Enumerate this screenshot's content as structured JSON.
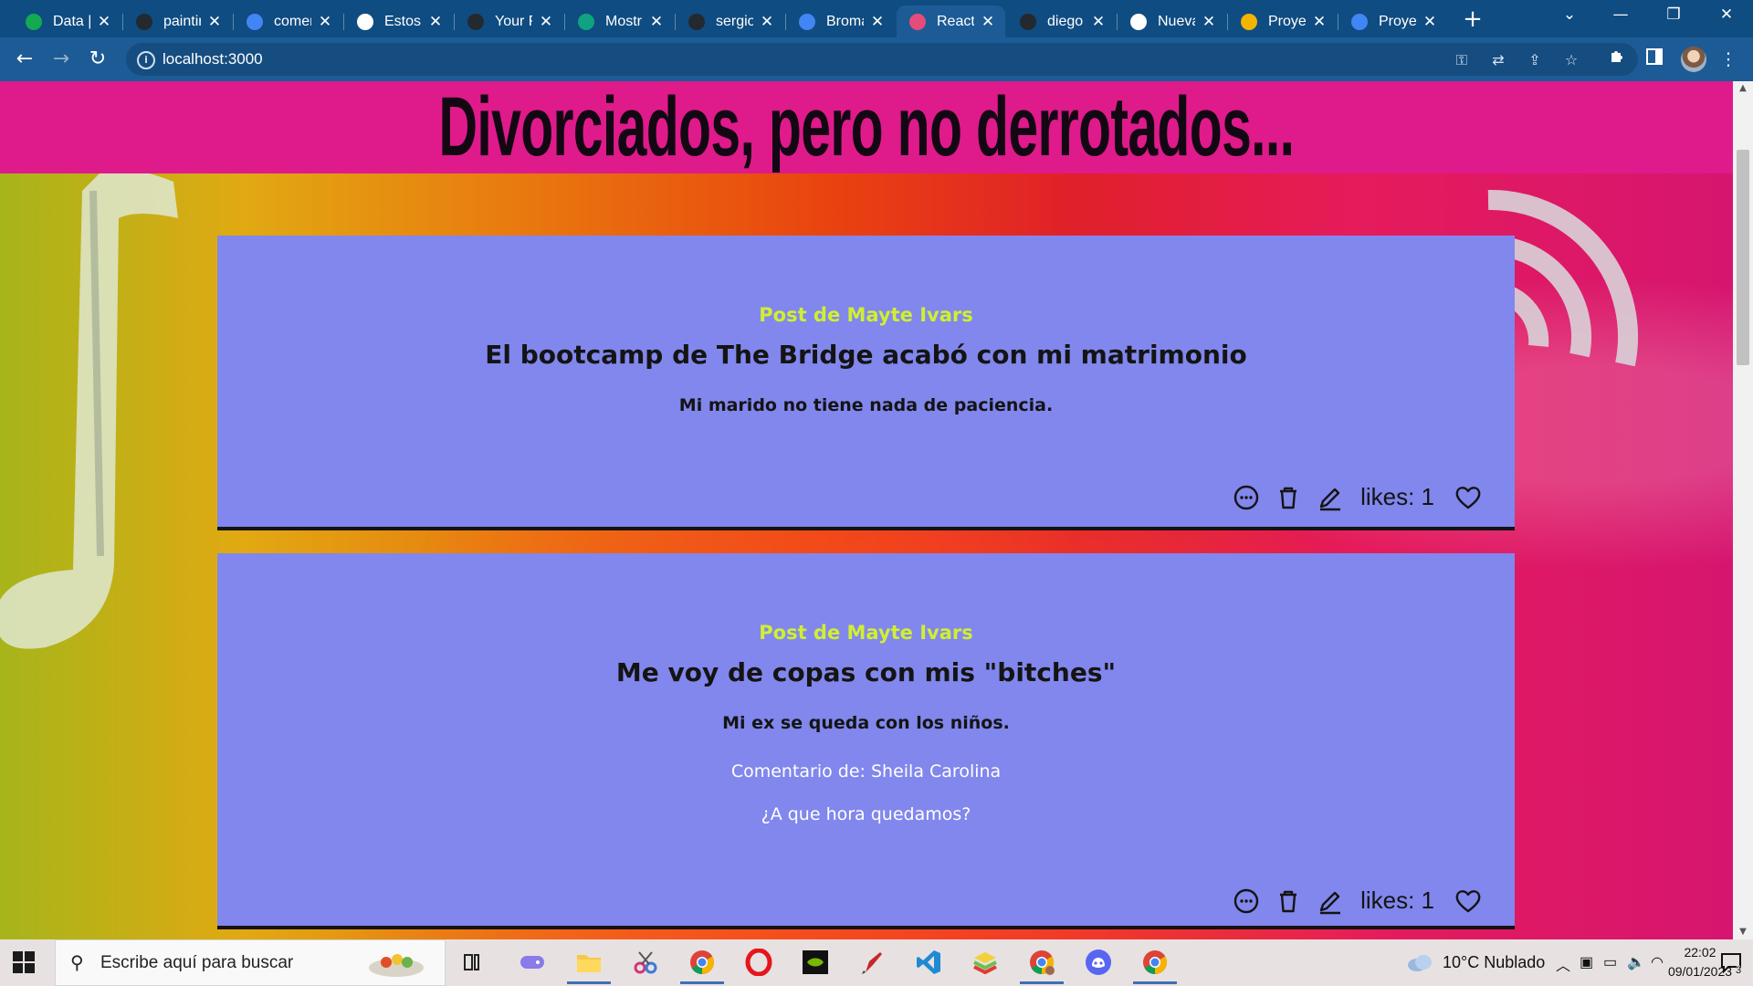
{
  "browser": {
    "tabs": [
      {
        "title": "Data |",
        "icon": "mongodb-leaf-icon",
        "color": "#13aa52"
      },
      {
        "title": "paintin",
        "icon": "github-icon",
        "color": "#24292f"
      },
      {
        "title": "comen",
        "icon": "google-icon",
        "color": "#4285f4"
      },
      {
        "title": "Estos",
        "icon": "skull-icon",
        "color": "#ffffff"
      },
      {
        "title": "Your R",
        "icon": "github-icon",
        "color": "#24292f"
      },
      {
        "title": "Mostr",
        "icon": "openai-icon",
        "color": "#10a37f"
      },
      {
        "title": "sergio",
        "icon": "github-icon",
        "color": "#24292f"
      },
      {
        "title": "Broma",
        "icon": "google-icon",
        "color": "#4285f4"
      },
      {
        "title": "React",
        "icon": "react-app-icon",
        "color": "#e54c7a",
        "active": true
      },
      {
        "title": "diego",
        "icon": "github-icon",
        "color": "#24292f"
      },
      {
        "title": "Nueva",
        "icon": "chrome-icon",
        "color": "#ffffff"
      },
      {
        "title": "Proye",
        "icon": "classroom-icon",
        "color": "#f4b400"
      },
      {
        "title": "Proye",
        "icon": "docs-icon",
        "color": "#4285f4"
      }
    ],
    "address": "localhost:3000"
  },
  "page": {
    "banner_title": "Divorciados, pero no derrotados...",
    "banner_color": "#df1a8b",
    "card_color": "#8187ec",
    "author_color": "#d0ef32",
    "posts": [
      {
        "author": "Post de Mayte Ivars",
        "title": "El bootcamp de The Bridge acabó con mi matrimonio",
        "body": "Mi marido no tiene nada de paciencia.",
        "likes": "likes: 1"
      },
      {
        "author": "Post de Mayte Ivars",
        "title": "Me voy de copas con mis \"bitches\"",
        "body": "Mi ex se queda con los niños.",
        "comment_author": "Comentario de: Sheila Carolina",
        "comment_text": "¿A que hora quedamos?",
        "likes": "likes: 1"
      }
    ]
  },
  "taskbar": {
    "search_placeholder": "Escribe aquí para buscar",
    "apps": [
      "task-view-icon",
      "gamepad-app-icon",
      "file-explorer-icon",
      "snipping-tool-icon",
      "chrome-icon",
      "opera-icon",
      "nvidia-icon",
      "paint-brush-app-icon",
      "vscode-icon",
      "bluestacks-icon",
      "chrome-profile-icon",
      "discord-icon",
      "chrome-icon"
    ],
    "weather": "10°C  Nublado",
    "time": "22:02",
    "date": "09/01/2023",
    "notifications": "3"
  }
}
